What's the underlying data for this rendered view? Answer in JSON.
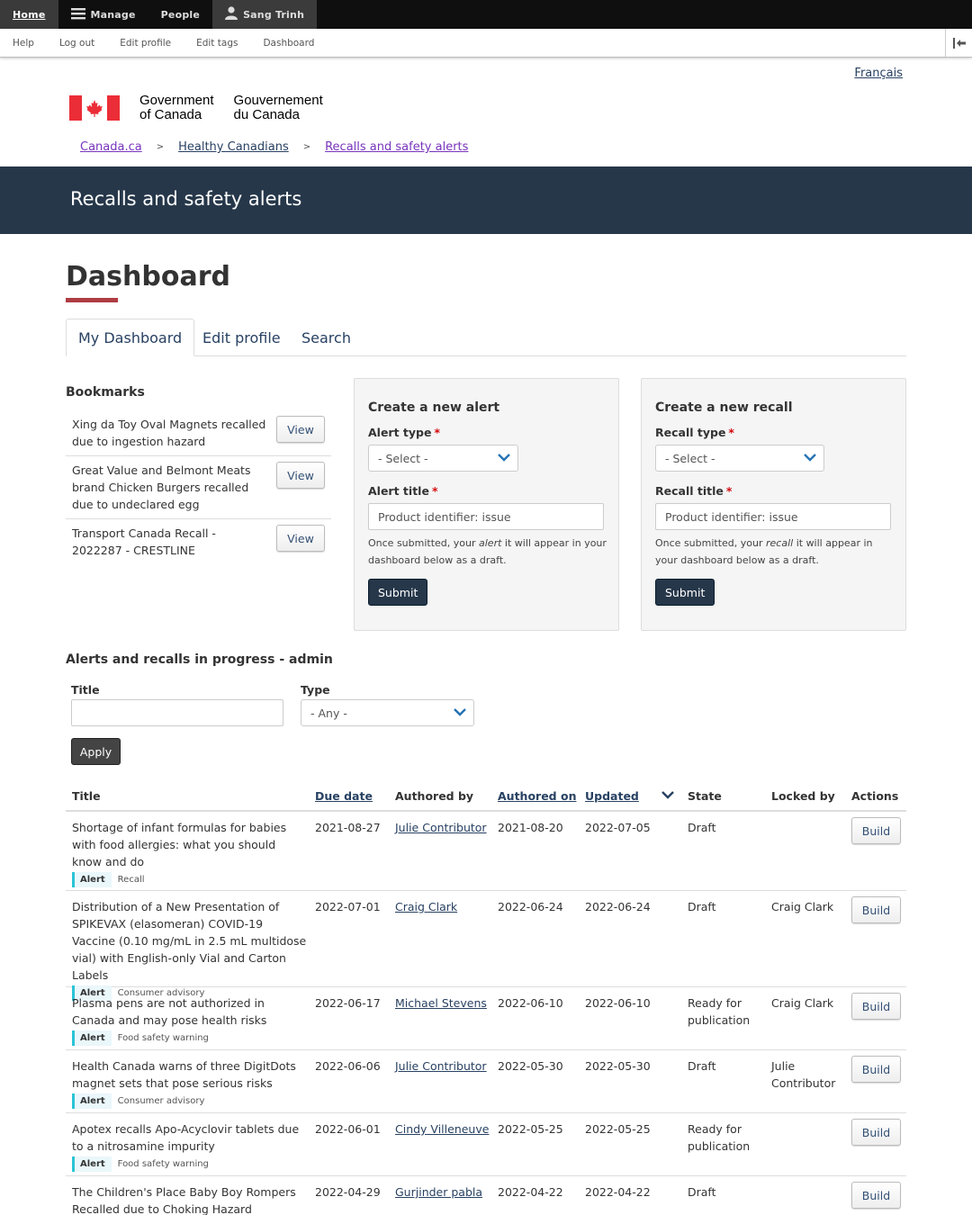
{
  "toolbar": {
    "home": "Home",
    "manage": "Manage",
    "people": "People",
    "user": "Sang Trinh",
    "sub_items": [
      "Help",
      "Log out",
      "Edit profile",
      "Edit tags",
      "Dashboard"
    ]
  },
  "header": {
    "language_link": "Français",
    "signature_en_1": "Government",
    "signature_en_2": "of Canada",
    "signature_fr_1": "Gouvernement",
    "signature_fr_2": "du Canada",
    "breadcrumbs": [
      "Canada.ca",
      "Healthy Canadians",
      "Recalls and safety alerts"
    ],
    "breadcrumb_sep": ">"
  },
  "banner": {
    "title": "Recalls and safety alerts"
  },
  "page": {
    "title": "Dashboard",
    "tabs": [
      "My Dashboard",
      "Edit profile",
      "Search"
    ]
  },
  "bookmarks": {
    "heading": "Bookmarks",
    "view_label": "View",
    "items": [
      "Xing da Toy Oval Magnets recalled due to ingestion hazard",
      "Great Value and Belmont Meats brand Chicken Burgers recalled due to undeclared egg",
      "Transport Canada Recall - 2022287 - CRESTLINE"
    ]
  },
  "create_alert": {
    "heading": "Create a new alert",
    "type_label": "Alert type",
    "type_value": "- Select -",
    "title_label": "Alert title",
    "title_placeholder": "Product identifier: issue",
    "help_pre": "Once submitted, your ",
    "help_em": "alert",
    "help_post": " it will appear in your dashboard below as a draft.",
    "submit": "Submit"
  },
  "create_recall": {
    "heading": "Create a new recall",
    "type_label": "Recall type",
    "type_value": "- Select -",
    "title_label": "Recall title",
    "title_placeholder": "Product identifier: issue",
    "help_pre": "Once submitted, your ",
    "help_em": "recall",
    "help_post": " it will appear in your dashboard below as a draft.",
    "submit": "Submit"
  },
  "in_progress": {
    "heading": "Alerts and recalls in progress - admin",
    "filter_title_label": "Title",
    "filter_title_value": "",
    "filter_type_label": "Type",
    "filter_type_value": "- Any -",
    "apply": "Apply",
    "columns": [
      "Title",
      "Due date",
      "Authored by",
      "Authored on",
      "Updated",
      "State",
      "Locked by",
      "Actions"
    ],
    "build_label": "Build",
    "rows": [
      {
        "title": "Shortage of infant formulas for babies with food allergies: what you should know and do",
        "tag": "Alert",
        "sub": "Recall",
        "due": "2021-08-27",
        "author": "Julie Contributor",
        "authored_on": "2021-08-20",
        "updated": "2022-07-05",
        "state": "Draft",
        "locked": ""
      },
      {
        "title": "Distribution of a New Presentation of SPIKEVAX (elasomeran) COVID-19 Vaccine (0.10 mg/mL in 2.5 mL multidose vial) with English-only Vial and Carton Labels",
        "tag": "Alert",
        "sub": "Consumer advisory",
        "due": "2022-07-01",
        "author": "Craig Clark",
        "authored_on": "2022-06-24",
        "updated": "2022-06-24",
        "state": "Draft",
        "locked": "Craig Clark"
      },
      {
        "title": "Plasma pens are not authorized in Canada and may pose health risks",
        "tag": "Alert",
        "sub": "Food safety warning",
        "due": "2022-06-17",
        "author": "Michael Stevens",
        "authored_on": "2022-06-10",
        "updated": "2022-06-10",
        "state": "Ready for publication",
        "locked": "Craig Clark"
      },
      {
        "title": "Health Canada warns of three DigitDots magnet sets that pose serious risks",
        "tag": "Alert",
        "sub": "Consumer advisory",
        "due": "2022-06-06",
        "author": "Julie Contributor",
        "authored_on": "2022-05-30",
        "updated": "2022-05-30",
        "state": "Draft",
        "locked": "Julie Contributor"
      },
      {
        "title": "Apotex recalls Apo-Acyclovir tablets due to a nitrosamine impurity",
        "tag": "Alert",
        "sub": "Food safety warning",
        "due": "2022-06-01",
        "author": "Cindy Villeneuve",
        "authored_on": "2022-05-25",
        "updated": "2022-05-25",
        "state": "Ready for publication",
        "locked": ""
      },
      {
        "title": "The Children's Place Baby Boy Rompers Recalled due to Choking Hazard",
        "tag": "",
        "sub": "",
        "due": "2022-04-29",
        "author": "Gurjinder pabla",
        "authored_on": "2022-04-22",
        "updated": "2022-04-22",
        "state": "Draft",
        "locked": ""
      }
    ]
  }
}
